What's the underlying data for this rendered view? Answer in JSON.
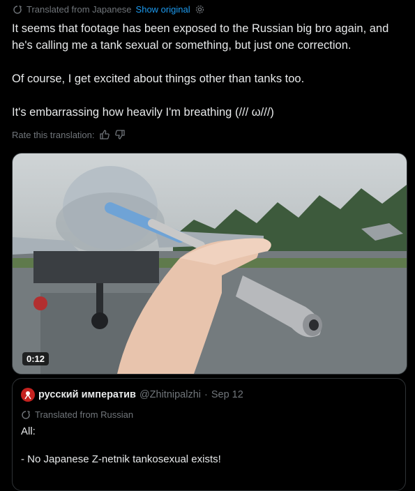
{
  "translation": {
    "label": "Translated from Japanese",
    "show_original": "Show original",
    "settings_icon": "gear-icon",
    "translate_icon": "translate-icon"
  },
  "tweet": {
    "paragraphs": [
      "It seems that footage has been exposed to the Russian big bro again, and he's calling me a tank sexual or something, but just one correction.",
      "Of course, I get excited about things other than tanks too.",
      "It's embarrassing how heavily I'm breathing (/// ω///)"
    ]
  },
  "rating": {
    "label": "Rate this translation:",
    "up_icon": "thumbs-up-icon",
    "down_icon": "thumbs-down-icon"
  },
  "media": {
    "duration": "0:12"
  },
  "quote": {
    "name": "русский императив",
    "handle": "@Zhitnipalzhi",
    "separator": "·",
    "date": "Sep 12",
    "translated_label": "Translated from Russian",
    "paragraphs": [
      "All:",
      "- No Japanese Z-netnik tankosexual exists!"
    ]
  },
  "colors": {
    "background": "#000000",
    "text": "#e7e9ea",
    "muted": "#71767b",
    "link": "#1d9bf0",
    "border": "#2f3336"
  }
}
